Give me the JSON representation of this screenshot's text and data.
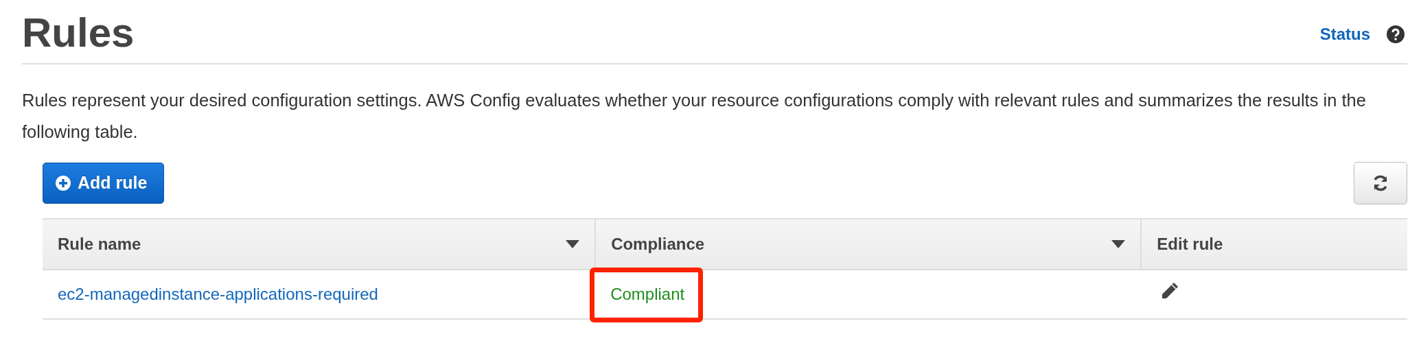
{
  "header": {
    "title": "Rules",
    "status_link": "Status"
  },
  "description": "Rules represent your desired configuration settings. AWS Config evaluates whether your resource configurations comply with relevant rules and summarizes the results in the following table.",
  "add_button": "Add rule",
  "table": {
    "columns": [
      {
        "label": "Rule name",
        "sortable": true
      },
      {
        "label": "Compliance",
        "sortable": true
      },
      {
        "label": "Edit rule",
        "sortable": false
      }
    ],
    "rows": [
      {
        "rule_name": "ec2-managedinstance-applications-required",
        "compliance": "Compliant",
        "highlighted": true
      }
    ]
  }
}
